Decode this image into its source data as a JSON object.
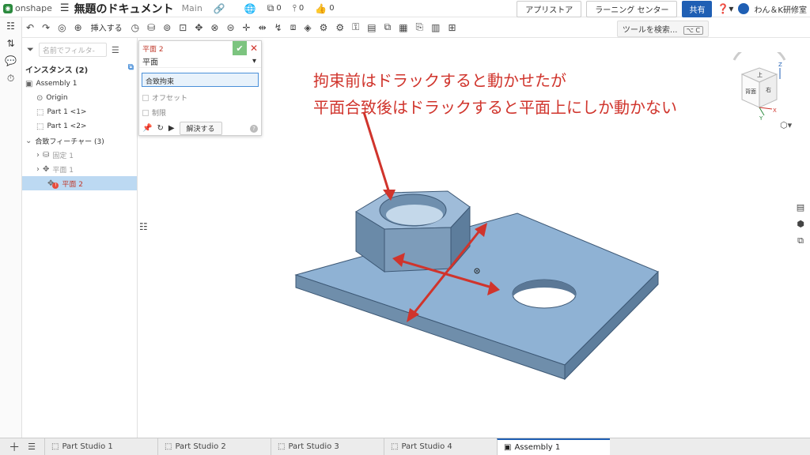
{
  "header": {
    "logo_text": "onshape",
    "doc_title": "無題のドキュメント",
    "branch": "Main",
    "versions_count": "0",
    "branches_count": "0",
    "likes_count": "0",
    "app_store": "アプリストア",
    "learning": "ラーニング センター",
    "share": "共有",
    "user": "わん＆K研修室"
  },
  "toolbar": {
    "insert_label": "挿入する",
    "search_label": "ツールを検索...",
    "search_shortcut": "⌥ C"
  },
  "panel": {
    "filter_placeholder": "名前でフィルタ-",
    "instances_header": "インスタンス (2)",
    "items": [
      {
        "label": "Assembly 1"
      },
      {
        "label": "Origin"
      },
      {
        "label": "Part 1 <1>"
      },
      {
        "label": "Part 1 <2>"
      }
    ],
    "mates_header": "合致フィーチャー (3)",
    "mates": [
      {
        "label": "固定 1"
      },
      {
        "label": "平面 1"
      },
      {
        "label": "平面 2"
      }
    ]
  },
  "mate_dialog": {
    "name": "平面 2",
    "type": "平面",
    "field": "合致拘束",
    "offset": "オフセット",
    "limits": "制限",
    "solve": "解決する"
  },
  "annotation": {
    "line1": "拘束前はドラックすると動かせたが",
    "line2": "平面合致後はドラックすると平面上にしか動かない"
  },
  "view_cube": {
    "top": "上",
    "front": "背面",
    "right": "右",
    "axis_x": "X",
    "axis_y": "Y",
    "axis_z": "Z"
  },
  "tabs": [
    {
      "label": "Part Studio 1"
    },
    {
      "label": "Part Studio 2"
    },
    {
      "label": "Part Studio 3"
    },
    {
      "label": "Part Studio 4"
    },
    {
      "label": "Assembly 1"
    }
  ],
  "colors": {
    "accent": "#1f5fb4",
    "annotation": "#d0342c",
    "part": "#8fb2d4"
  }
}
